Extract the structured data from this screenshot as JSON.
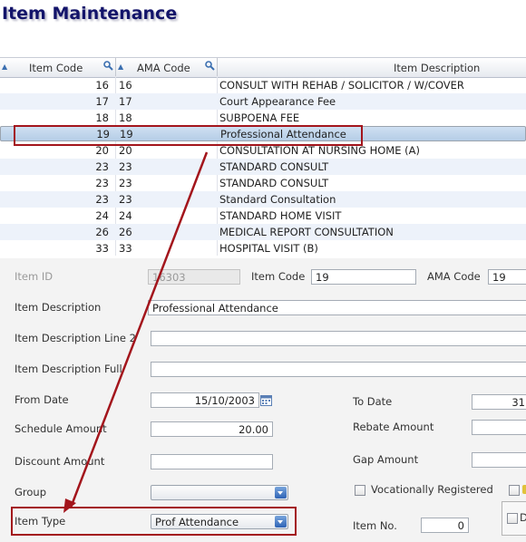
{
  "page_title": "Item Maintenance",
  "grid": {
    "headers": {
      "item_code": "Item Code",
      "ama_code": "AMA Code",
      "item_description": "Item Description"
    },
    "rows": [
      {
        "code": "16",
        "ama": "16",
        "desc": "CONSULT WITH REHAB / SOLICITOR / W/COVER"
      },
      {
        "code": "17",
        "ama": "17",
        "desc": "Court Appearance Fee"
      },
      {
        "code": "18",
        "ama": "18",
        "desc": "SUBPOENA FEE"
      },
      {
        "code": "19",
        "ama": "19",
        "desc": "Professional Attendance"
      },
      {
        "code": "20",
        "ama": "20",
        "desc": "CONSULTATION AT NURSING HOME (A)"
      },
      {
        "code": "23",
        "ama": "23",
        "desc": "STANDARD CONSULT"
      },
      {
        "code": "23",
        "ama": "23",
        "desc": "STANDARD CONSULT"
      },
      {
        "code": "23",
        "ama": "23",
        "desc": "Standard Consultation"
      },
      {
        "code": "24",
        "ama": "24",
        "desc": "STANDARD HOME VISIT"
      },
      {
        "code": "26",
        "ama": "26",
        "desc": "MEDICAL REPORT CONSULTATION"
      },
      {
        "code": "33",
        "ama": "33",
        "desc": "HOSPITAL VISIT (B)"
      }
    ]
  },
  "form": {
    "item_id": {
      "label": "Item ID",
      "value": "16303"
    },
    "item_code": {
      "label": "Item Code",
      "value": "19"
    },
    "ama_code": {
      "label": "AMA Code",
      "value": "19"
    },
    "item_description": {
      "label": "Item Description",
      "value": "Professional Attendance"
    },
    "item_description_line2": {
      "label": "Item Description Line 2",
      "value": ""
    },
    "item_description_full": {
      "label": "Item Description Full",
      "value": ""
    },
    "from_date": {
      "label": "From Date",
      "value": "15/10/2003"
    },
    "to_date": {
      "label": "To Date",
      "value": "31"
    },
    "schedule_amount": {
      "label": "Schedule Amount",
      "value": "20.00"
    },
    "rebate_amount": {
      "label": "Rebate Amount",
      "value": ""
    },
    "discount_amount": {
      "label": "Discount Amount",
      "value": ""
    },
    "gap_amount": {
      "label": "Gap Amount",
      "value": ""
    },
    "group": {
      "label": "Group",
      "value": ""
    },
    "vocationally_registered": {
      "label": "Vocationally Registered"
    },
    "item_type": {
      "label": "Item Type",
      "value": "Prof Attendance"
    },
    "item_no": {
      "label": "Item No.",
      "value": "0"
    },
    "partial_checkbox_label": "D"
  },
  "colors": {
    "annotation_red": "#a3151c",
    "title_navy": "#13146a",
    "selected_row": "#b5cde6",
    "alt_row": "#edf2fa"
  }
}
